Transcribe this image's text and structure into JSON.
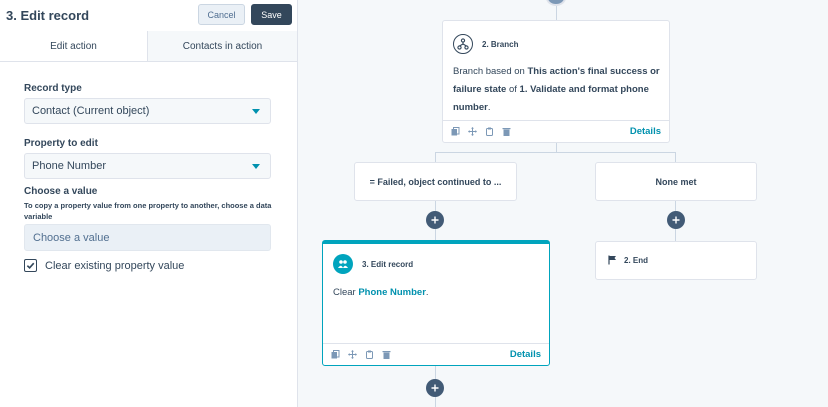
{
  "panel": {
    "title": "3. Edit record",
    "cancel_label": "Cancel",
    "save_label": "Save",
    "tabs": [
      {
        "label": "Edit action"
      },
      {
        "label": "Contacts in action"
      }
    ]
  },
  "form": {
    "record_type_label": "Record type",
    "record_type_value": "Contact (Current object)",
    "property_label": "Property to edit",
    "property_value": "Phone Number",
    "choose_value_label": "Choose a value",
    "choose_value_help": "To copy a property value from one property to another, choose a data variable",
    "choose_value_placeholder": "Choose a value",
    "clear_label": "Clear existing property value",
    "clear_checked": true
  },
  "canvas": {
    "branch_card": {
      "title": "2. Branch",
      "body_prefix": "Branch based on ",
      "body_bold": "This action's final success or failure state",
      "body_mid": " of ",
      "body_bold2": "1.  Validate and format phone number",
      "body_suffix": ".",
      "details_label": "Details"
    },
    "branch_left_label": "= Failed, object continued to ...",
    "branch_right_label": "None met",
    "edit_card": {
      "title": "3. Edit record",
      "body_prefix": "Clear ",
      "body_link": "Phone Number",
      "body_suffix": ".",
      "details_label": "Details"
    },
    "end_card": {
      "title": "2. End"
    }
  },
  "colors": {
    "accent_teal": "#00a4bd",
    "link_teal": "#0091ae",
    "dark": "#33475b",
    "plus_button": "#425b76",
    "connector": "#cbd6e2"
  }
}
